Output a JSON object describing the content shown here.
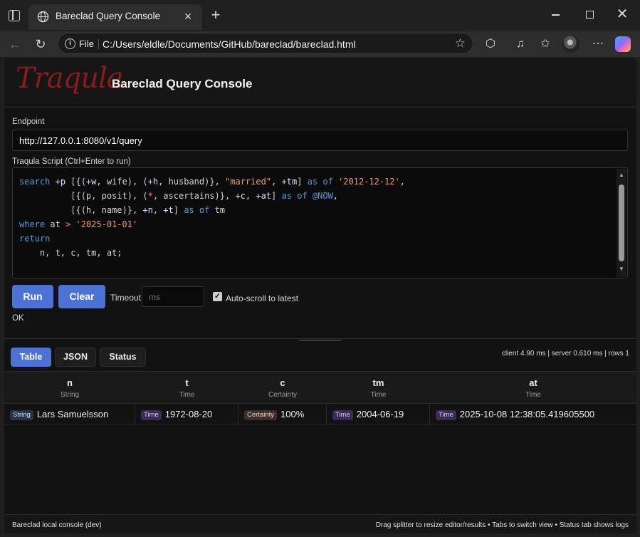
{
  "browser": {
    "tab_title": "Bareclad Query Console",
    "scheme_label": "File",
    "url": "C:/Users/eldle/Documents/GitHub/bareclad/bareclad.html"
  },
  "app": {
    "logo_text": "Traqula",
    "title": "Bareclad Query Console"
  },
  "endpoint": {
    "label": "Endpoint",
    "value": "http://127.0.0.1:8080/v1/query"
  },
  "script": {
    "label": "Traqula Script (Ctrl+Enter to run)",
    "lines": [
      "search +p [{(+w, wife), (+h, husband)}, \"married\", +tm] as of '2012-12-12',",
      "          [{(p, posit), (*, ascertains)}, +c, +at] as of @NOW,",
      "          [{(h, name)}, +n, +t] as of tm",
      "where at > '2025-01-01'",
      "return",
      "    n, t, c, tm, at;"
    ]
  },
  "controls": {
    "run_label": "Run",
    "clear_label": "Clear",
    "timeout_label": "Timeout",
    "timeout_placeholder": "ms",
    "autoscroll_label": "Auto-scroll to latest",
    "status": "OK"
  },
  "results_tabs": [
    "Table",
    "JSON",
    "Status"
  ],
  "timings": "client 4.90 ms | server 0.610 ms | rows 1",
  "table": {
    "columns": [
      {
        "name": "n",
        "type": "String"
      },
      {
        "name": "t",
        "type": "Time"
      },
      {
        "name": "c",
        "type": "Certainty"
      },
      {
        "name": "tm",
        "type": "Time"
      },
      {
        "name": "at",
        "type": "Time"
      }
    ],
    "rows": [
      [
        {
          "badge": "String",
          "value": "Lars Samuelsson"
        },
        {
          "badge": "Time",
          "value": "1972-08-20"
        },
        {
          "badge": "Certainty",
          "value": "100%"
        },
        {
          "badge": "Time",
          "value": "2004-06-19"
        },
        {
          "badge": "Time",
          "value": "2025-10-08 12:38:05.419605500"
        }
      ]
    ]
  },
  "footer": {
    "left": "Bareclad local console (dev)",
    "right": "Drag splitter to resize editor/results • Tabs to switch view • Status tab shows logs"
  },
  "colors": {
    "accent": "#4d72d6",
    "logo": "#8b1a1a",
    "keyword": "#569cd6",
    "string": "#e8a06a"
  }
}
